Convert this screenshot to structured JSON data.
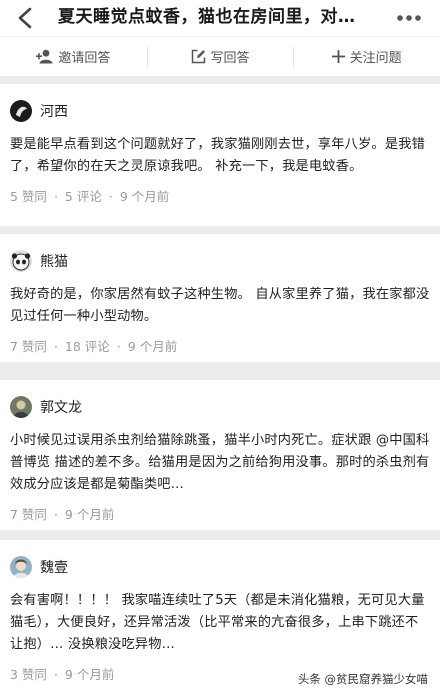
{
  "nav": {
    "title": "夏天睡觉点蚊香，猫也在房间里，对…"
  },
  "actions": {
    "invite": "邀请回答",
    "write": "写回答",
    "follow": "关注问题"
  },
  "answers": [
    {
      "author": "河西",
      "content": "要是能早点看到这个问题就好了，我家猫刚刚去世，享年八岁。是我错了，希望你的在天之灵原谅我吧。 补充一下，我是电蚊香。",
      "likes": "5 赞同",
      "comments": "5 评论",
      "time": "9 个月前"
    },
    {
      "author": "熊猫",
      "content": "我好奇的是，你家居然有蚊子这种生物。 自从家里养了猫，我在家都没见过任何一种小型动物。",
      "likes": "7 赞同",
      "comments": "18 评论",
      "time": "9 个月前"
    },
    {
      "author": "郭文龙",
      "content": "小时候见过误用杀虫剂给猫除跳蚤，猫半小时内死亡。症状跟 @中国科普博览 描述的差不多。给猫用是因为之前给狗用没事。那时的杀虫剂有效成分应该是都是菊酯类吧…",
      "likes": "7 赞同",
      "time": "9 个月前"
    },
    {
      "author": "魏壹",
      "content": "会有害啊！！！！ 我家喵连续吐了5天（都是未消化猫粮，无可见大量猫毛），大便良好，还异常活泼（比平常来的亢奋很多，上串下跳还不让抱）… 没换粮没吃异物…",
      "likes": "3 赞同",
      "time": "9 个月前"
    }
  ],
  "watermark": "头条 @贫民窟养猫少女喵"
}
